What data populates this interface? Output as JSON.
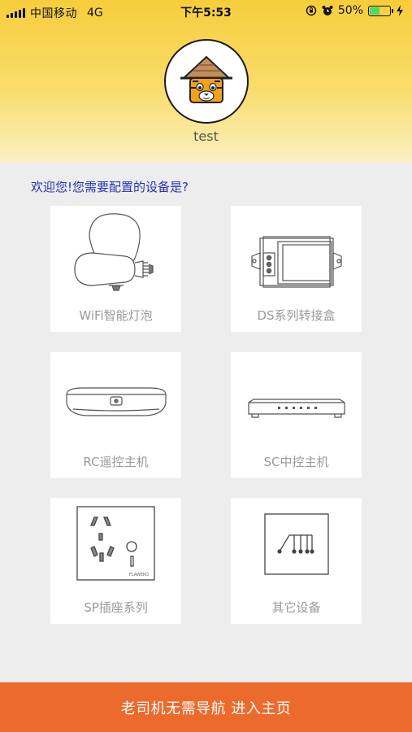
{
  "status_bar": {
    "carrier": "中国移动",
    "network": "4G",
    "time": "下午5:53",
    "battery_text": "50%",
    "battery_level": 0.5,
    "icons": [
      "signal-icon",
      "rotation-lock-icon",
      "alarm-icon",
      "battery-icon",
      "charging-icon"
    ]
  },
  "profile": {
    "avatar_icon": "tiger-avatar-icon",
    "username": "test"
  },
  "prompt": "欢迎您!您需要配置的设备是?",
  "devices": [
    {
      "label": "WiFi智能灯泡",
      "icon": "bulb-icon"
    },
    {
      "label": "DS系列转接盒",
      "icon": "adapter-box-icon"
    },
    {
      "label": "RC遥控主机",
      "icon": "rc-host-icon"
    },
    {
      "label": "SC中控主机",
      "icon": "sc-host-icon"
    },
    {
      "label": "SP插座系列",
      "icon": "socket-icon"
    },
    {
      "label": "其它设备",
      "icon": "switch-panel-icon"
    }
  ],
  "socket_brand": "FLAWEKO",
  "footer_button": "老司机无需导航 进入主页",
  "colors": {
    "header_top": "#f7cd3c",
    "prompt_text": "#2433b8",
    "footer_bg": "#ec6a2c",
    "card_label": "#9a9a9a"
  }
}
